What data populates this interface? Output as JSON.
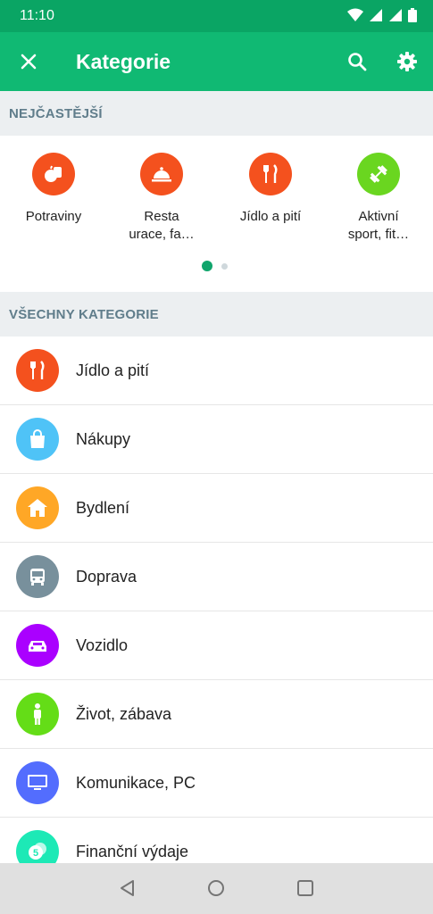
{
  "status": {
    "time": "11:10"
  },
  "appbar": {
    "title": "Kategorie"
  },
  "sections": {
    "frequent": "NEJČASTĚJŠÍ",
    "all": "VŠECHNY KATEGORIE"
  },
  "frequent_items": [
    {
      "label": "Potraviny",
      "icon": "groceries-icon",
      "color": "#f4511e"
    },
    {
      "label": "Resta\nurace, fa…",
      "icon": "restaurant-icon",
      "color": "#f4511e"
    },
    {
      "label": "Jídlo a pití",
      "icon": "food-drink-icon",
      "color": "#f4511e"
    },
    {
      "label": "Aktivní\nsport, fit…",
      "icon": "dumbbell-icon",
      "color": "#6ad620"
    }
  ],
  "categories": [
    {
      "label": "Jídlo a pití",
      "icon": "food-drink-icon",
      "color": "#f4511e"
    },
    {
      "label": "Nákupy",
      "icon": "shopping-bag-icon",
      "color": "#4fc3f7"
    },
    {
      "label": "Bydlení",
      "icon": "house-icon",
      "color": "#ffa726"
    },
    {
      "label": "Doprava",
      "icon": "bus-icon",
      "color": "#78909c"
    },
    {
      "label": "Vozidlo",
      "icon": "car-icon",
      "color": "#aa00ff"
    },
    {
      "label": "Život, zábava",
      "icon": "person-icon",
      "color": "#64dd17"
    },
    {
      "label": "Komunikace, PC",
      "icon": "computer-icon",
      "color": "#536dfe"
    },
    {
      "label": "Finanční výdaje",
      "icon": "coins-icon",
      "color": "#1de9b6"
    }
  ],
  "colors": {
    "statusbar": "#0aa564",
    "appbar": "#10b973",
    "accent": "#10a56c"
  }
}
